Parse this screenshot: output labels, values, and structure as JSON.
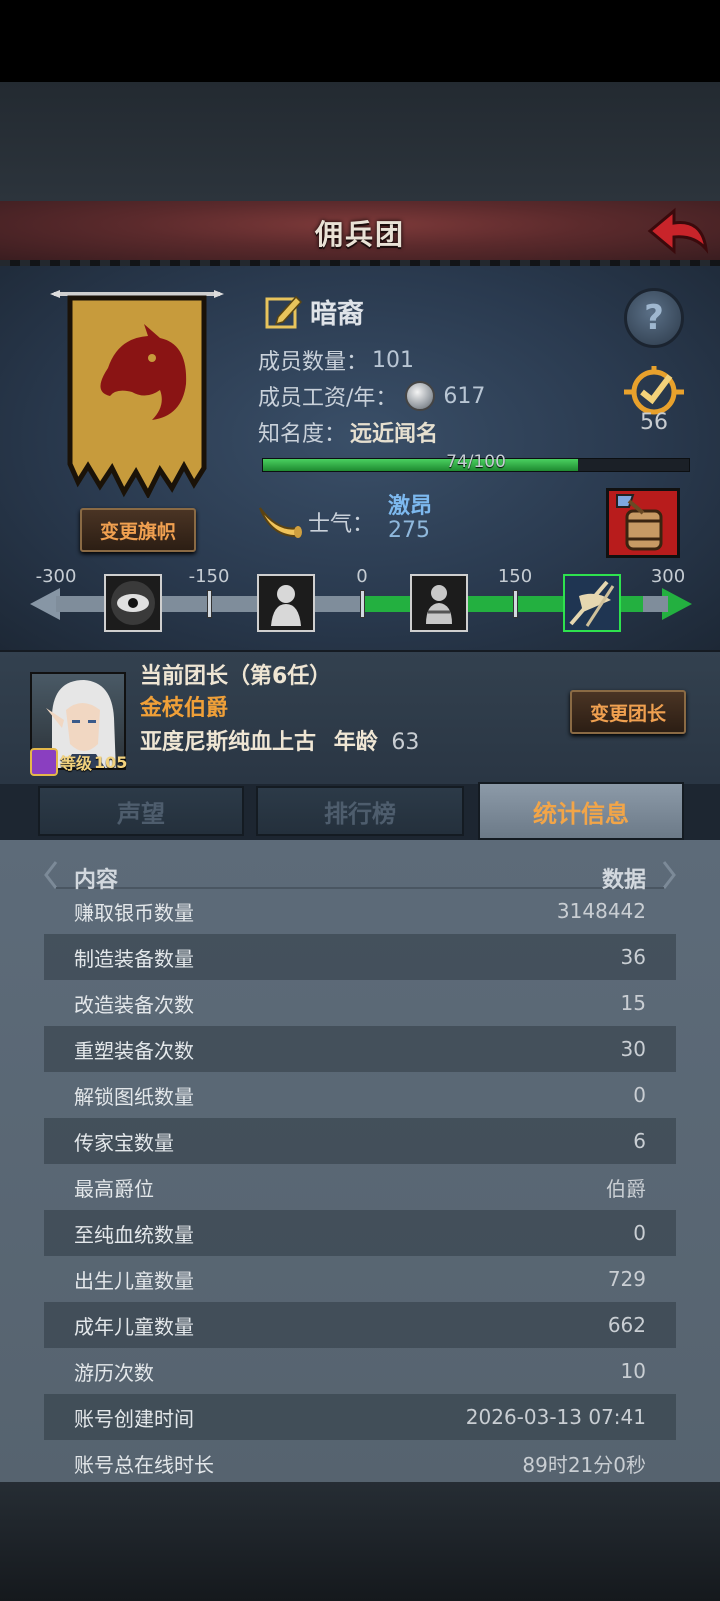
{
  "header": {
    "title": "佣兵团"
  },
  "company": {
    "name": "暗裔",
    "member_count_label": "成员数量：",
    "member_count": "101",
    "wage_label": "成员工资/年：",
    "wage": "617",
    "fame_label": "知名度：",
    "fame_level": "远近闻名",
    "fame_progress_text": "74/100",
    "fame_progress": 0.74,
    "badge_value": "56",
    "change_flag_label": "变更旗帜"
  },
  "morale": {
    "label": "士气：",
    "state": "激昂",
    "value": "275",
    "scale": {
      "min": -300,
      "max": 300,
      "current": 275
    },
    "tick_labels": [
      "-300",
      "-150",
      "0",
      "150",
      "300"
    ],
    "icons": [
      "eye-icon",
      "despair-figure-icon",
      "calm-figure-icon",
      "victory-banner-icon"
    ]
  },
  "leader": {
    "title": "当前团长（第6任）",
    "rank": "金枝伯爵",
    "lineage": "亚度尼斯纯血上古",
    "age_label": "年龄",
    "age": "63",
    "level_label": "等级",
    "level": "105",
    "change_leader_label": "变更团长"
  },
  "tabs": [
    {
      "label": "声望",
      "active": false
    },
    {
      "label": "排行榜",
      "active": false
    },
    {
      "label": "统计信息",
      "active": true
    }
  ],
  "table": {
    "col_left": "内容",
    "col_right": "数据",
    "rows": [
      {
        "name": "赚取银币数量",
        "value": "3148442"
      },
      {
        "name": "制造装备数量",
        "value": "36"
      },
      {
        "name": "改造装备次数",
        "value": "15"
      },
      {
        "name": "重塑装备次数",
        "value": "30"
      },
      {
        "name": "解锁图纸数量",
        "value": "0"
      },
      {
        "name": "传家宝数量",
        "value": "6"
      },
      {
        "name": "最高爵位",
        "value": "伯爵"
      },
      {
        "name": "至纯血统数量",
        "value": "0"
      },
      {
        "name": "出生儿童数量",
        "value": "729"
      },
      {
        "name": "成年儿童数量",
        "value": "662"
      },
      {
        "name": "游历次数",
        "value": "10"
      },
      {
        "name": "账号创建时间",
        "value": "2026-03-13 07:41"
      },
      {
        "name": "账号总在线时长",
        "value": "89时21分0秒"
      }
    ]
  },
  "colors": {
    "accent_orange": "#f0a050",
    "morale_blue": "#7db9ef",
    "bar_green": "#23b040",
    "title_red": "#6b2f31"
  }
}
